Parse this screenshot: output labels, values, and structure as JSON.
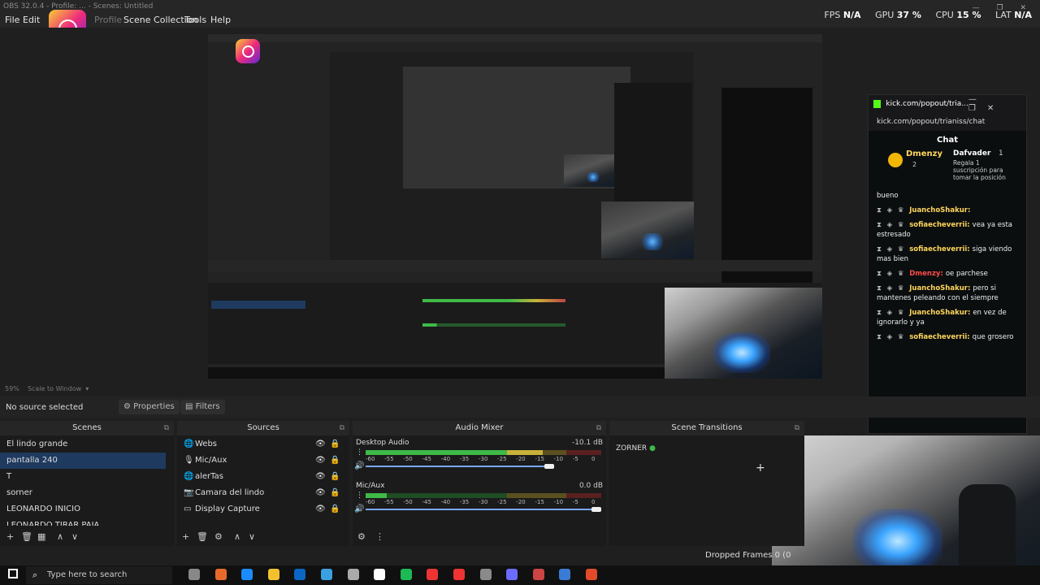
{
  "window": {
    "title": "OBS 32.0.4 - Profile: ... - Scenes: Untitled",
    "controls": [
      "—",
      "❐",
      "✕"
    ]
  },
  "menu": {
    "file": "File",
    "edit": "Edit",
    "profile": "Profile",
    "scene_collection": "Scene Collection",
    "tools": "Tools",
    "help": "Help"
  },
  "stats": {
    "fps_label": "FPS",
    "fps_value": "N/A",
    "gpu_label": "GPU",
    "gpu_value": "37 %",
    "cpu_label": "CPU",
    "cpu_value": "15 %",
    "lat_label": "LAT",
    "lat_value": "N/A"
  },
  "preview": {
    "zoom": "59%",
    "scale_mode": "Scale to Window"
  },
  "source_bar": {
    "no_source": "No source selected",
    "properties": "Properties",
    "filters": "Filters"
  },
  "scenes_dock": {
    "title": "Scenes",
    "items": [
      {
        "label": "El lindo grande",
        "selected": false
      },
      {
        "label": "pantalla 240",
        "selected": true
      },
      {
        "label": "T",
        "selected": false
      },
      {
        "label": "sorner",
        "selected": false
      },
      {
        "label": "LEONARDO INICIO",
        "selected": false
      },
      {
        "label": "LEONARDO TIRAR PAJA",
        "selected": false
      }
    ]
  },
  "sources_dock": {
    "title": "Sources",
    "items": [
      {
        "label": "Webs",
        "icon": "globe-icon"
      },
      {
        "label": "Mic/Aux",
        "icon": "microphone-icon"
      },
      {
        "label": "alerTas",
        "icon": "globe-icon"
      },
      {
        "label": "Camara del lindo",
        "icon": "camera-icon"
      },
      {
        "label": "Display Capture",
        "icon": "monitor-icon"
      }
    ]
  },
  "audio_mixer": {
    "title": "Audio Mixer",
    "channels": [
      {
        "name": "Desktop Audio",
        "db": "-10.1 dB",
        "level": 0.75,
        "volume": 0.8
      },
      {
        "name": "Mic/Aux",
        "db": "0.0 dB",
        "level": 0.09,
        "volume": 1.0
      }
    ],
    "ticks": [
      "-60",
      "-55",
      "-50",
      "-45",
      "-40",
      "-35",
      "-30",
      "-25",
      "-20",
      "-15",
      "-10",
      "-5",
      "0"
    ]
  },
  "scene_transitions": {
    "title": "Scene Transitions",
    "current": "ZORNER"
  },
  "status": {
    "dropped_frames": "Dropped Frames 0 (0"
  },
  "chat": {
    "window_title": "kick.com/popout/tria...",
    "url": "kick.com/popout/trianiss/chat",
    "header": "Chat",
    "pinned_user": "Dmenzy",
    "pinned_rank": "2",
    "gift_user": "Dafvader",
    "gift_count": "1",
    "gift_text": "Regala 1 suscripción para tomar la posición 3",
    "messages": [
      {
        "user": "",
        "text": "bueno",
        "color": ""
      },
      {
        "user": "JuanchoShakur:",
        "text": "",
        "color": "yellow"
      },
      {
        "user": "sofiaecheverrii:",
        "text": "vea ya esta estresado",
        "color": "yellow"
      },
      {
        "user": "sofiaecheverrii:",
        "text": "siga viendo mas bien",
        "color": "yellow"
      },
      {
        "user": "Dmenzy:",
        "text": "oe parchese",
        "color": "red"
      },
      {
        "user": "JuanchoShakur:",
        "text": "pero si mantenes peleando con el siempre",
        "color": "yellow"
      },
      {
        "user": "JuanchoShakur:",
        "text": "en vez de ignorarlo y ya",
        "color": "yellow"
      },
      {
        "user": "sofiaecheverrii:",
        "text": "que grosero",
        "color": "yellow"
      }
    ]
  },
  "taskbar": {
    "search_placeholder": "Type here to search"
  }
}
